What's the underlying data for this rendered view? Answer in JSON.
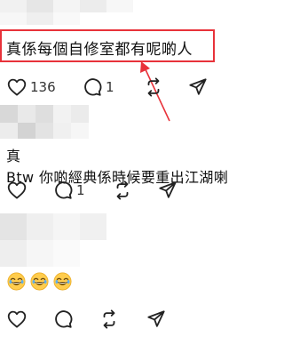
{
  "post1": {
    "text": "真係每個自修室都有呢啲人",
    "likes": "136",
    "replies": "1"
  },
  "post2": {
    "line1": "真",
    "line2": "Btw 你啲經典係時候要重出江湖喇",
    "replies": "1"
  },
  "post3": {
    "emojis": [
      "😂",
      "😂",
      "😂"
    ]
  },
  "colors": {
    "annotation_red": "#e8323a",
    "icon": "#222222"
  }
}
